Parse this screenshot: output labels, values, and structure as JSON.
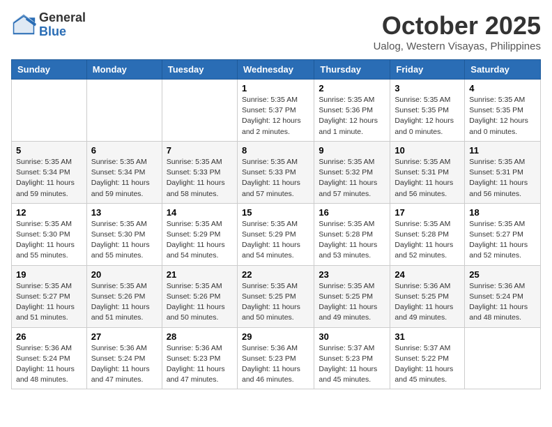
{
  "logo": {
    "general": "General",
    "blue": "Blue"
  },
  "title": "October 2025",
  "location": "Ualog, Western Visayas, Philippines",
  "days_of_week": [
    "Sunday",
    "Monday",
    "Tuesday",
    "Wednesday",
    "Thursday",
    "Friday",
    "Saturday"
  ],
  "weeks": [
    [
      {
        "day": "",
        "info": ""
      },
      {
        "day": "",
        "info": ""
      },
      {
        "day": "",
        "info": ""
      },
      {
        "day": "1",
        "info": "Sunrise: 5:35 AM\nSunset: 5:37 PM\nDaylight: 12 hours\nand 2 minutes."
      },
      {
        "day": "2",
        "info": "Sunrise: 5:35 AM\nSunset: 5:36 PM\nDaylight: 12 hours\nand 1 minute."
      },
      {
        "day": "3",
        "info": "Sunrise: 5:35 AM\nSunset: 5:35 PM\nDaylight: 12 hours\nand 0 minutes."
      },
      {
        "day": "4",
        "info": "Sunrise: 5:35 AM\nSunset: 5:35 PM\nDaylight: 12 hours\nand 0 minutes."
      }
    ],
    [
      {
        "day": "5",
        "info": "Sunrise: 5:35 AM\nSunset: 5:34 PM\nDaylight: 11 hours\nand 59 minutes."
      },
      {
        "day": "6",
        "info": "Sunrise: 5:35 AM\nSunset: 5:34 PM\nDaylight: 11 hours\nand 59 minutes."
      },
      {
        "day": "7",
        "info": "Sunrise: 5:35 AM\nSunset: 5:33 PM\nDaylight: 11 hours\nand 58 minutes."
      },
      {
        "day": "8",
        "info": "Sunrise: 5:35 AM\nSunset: 5:33 PM\nDaylight: 11 hours\nand 57 minutes."
      },
      {
        "day": "9",
        "info": "Sunrise: 5:35 AM\nSunset: 5:32 PM\nDaylight: 11 hours\nand 57 minutes."
      },
      {
        "day": "10",
        "info": "Sunrise: 5:35 AM\nSunset: 5:31 PM\nDaylight: 11 hours\nand 56 minutes."
      },
      {
        "day": "11",
        "info": "Sunrise: 5:35 AM\nSunset: 5:31 PM\nDaylight: 11 hours\nand 56 minutes."
      }
    ],
    [
      {
        "day": "12",
        "info": "Sunrise: 5:35 AM\nSunset: 5:30 PM\nDaylight: 11 hours\nand 55 minutes."
      },
      {
        "day": "13",
        "info": "Sunrise: 5:35 AM\nSunset: 5:30 PM\nDaylight: 11 hours\nand 55 minutes."
      },
      {
        "day": "14",
        "info": "Sunrise: 5:35 AM\nSunset: 5:29 PM\nDaylight: 11 hours\nand 54 minutes."
      },
      {
        "day": "15",
        "info": "Sunrise: 5:35 AM\nSunset: 5:29 PM\nDaylight: 11 hours\nand 54 minutes."
      },
      {
        "day": "16",
        "info": "Sunrise: 5:35 AM\nSunset: 5:28 PM\nDaylight: 11 hours\nand 53 minutes."
      },
      {
        "day": "17",
        "info": "Sunrise: 5:35 AM\nSunset: 5:28 PM\nDaylight: 11 hours\nand 52 minutes."
      },
      {
        "day": "18",
        "info": "Sunrise: 5:35 AM\nSunset: 5:27 PM\nDaylight: 11 hours\nand 52 minutes."
      }
    ],
    [
      {
        "day": "19",
        "info": "Sunrise: 5:35 AM\nSunset: 5:27 PM\nDaylight: 11 hours\nand 51 minutes."
      },
      {
        "day": "20",
        "info": "Sunrise: 5:35 AM\nSunset: 5:26 PM\nDaylight: 11 hours\nand 51 minutes."
      },
      {
        "day": "21",
        "info": "Sunrise: 5:35 AM\nSunset: 5:26 PM\nDaylight: 11 hours\nand 50 minutes."
      },
      {
        "day": "22",
        "info": "Sunrise: 5:35 AM\nSunset: 5:25 PM\nDaylight: 11 hours\nand 50 minutes."
      },
      {
        "day": "23",
        "info": "Sunrise: 5:35 AM\nSunset: 5:25 PM\nDaylight: 11 hours\nand 49 minutes."
      },
      {
        "day": "24",
        "info": "Sunrise: 5:36 AM\nSunset: 5:25 PM\nDaylight: 11 hours\nand 49 minutes."
      },
      {
        "day": "25",
        "info": "Sunrise: 5:36 AM\nSunset: 5:24 PM\nDaylight: 11 hours\nand 48 minutes."
      }
    ],
    [
      {
        "day": "26",
        "info": "Sunrise: 5:36 AM\nSunset: 5:24 PM\nDaylight: 11 hours\nand 48 minutes."
      },
      {
        "day": "27",
        "info": "Sunrise: 5:36 AM\nSunset: 5:24 PM\nDaylight: 11 hours\nand 47 minutes."
      },
      {
        "day": "28",
        "info": "Sunrise: 5:36 AM\nSunset: 5:23 PM\nDaylight: 11 hours\nand 47 minutes."
      },
      {
        "day": "29",
        "info": "Sunrise: 5:36 AM\nSunset: 5:23 PM\nDaylight: 11 hours\nand 46 minutes."
      },
      {
        "day": "30",
        "info": "Sunrise: 5:37 AM\nSunset: 5:23 PM\nDaylight: 11 hours\nand 45 minutes."
      },
      {
        "day": "31",
        "info": "Sunrise: 5:37 AM\nSunset: 5:22 PM\nDaylight: 11 hours\nand 45 minutes."
      },
      {
        "day": "",
        "info": ""
      }
    ]
  ]
}
